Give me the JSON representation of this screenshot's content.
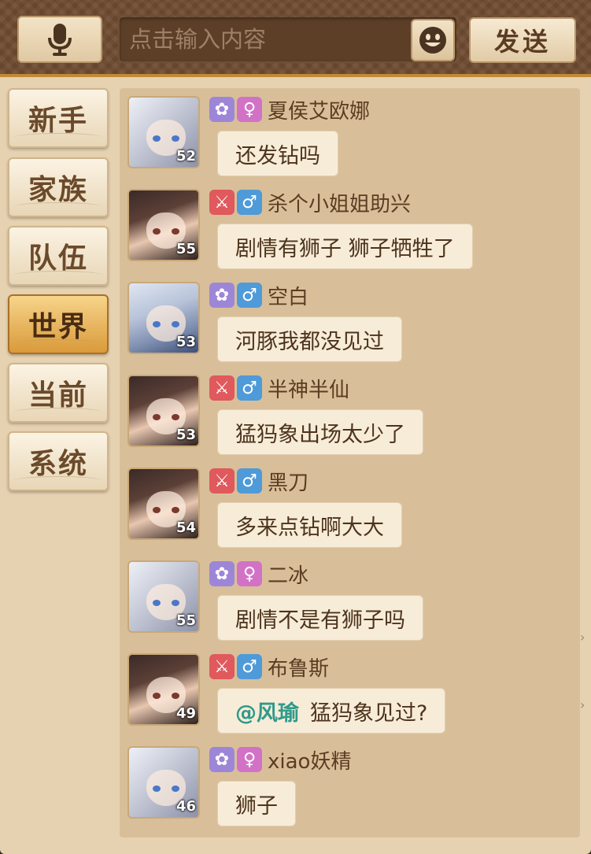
{
  "input": {
    "placeholder": "点击输入内容"
  },
  "toolbar": {
    "send_label": "发送"
  },
  "tabs": [
    {
      "label": "新手",
      "active": false
    },
    {
      "label": "家族",
      "active": false
    },
    {
      "label": "队伍",
      "active": false
    },
    {
      "label": "世界",
      "active": true
    },
    {
      "label": "当前",
      "active": false
    },
    {
      "label": "系统",
      "active": false
    }
  ],
  "messages": [
    {
      "name": "夏侯艾欧娜",
      "level": "52",
      "gender": "♀",
      "faction": "rose",
      "avatar": "silver-hair-girl",
      "text": "还发钻吗"
    },
    {
      "name": "杀个小姐姐助兴",
      "level": "55",
      "gender": "♂",
      "faction": "swords",
      "avatar": "dark-hair-boy",
      "text": "剧情有狮子 狮子牺牲了"
    },
    {
      "name": "空白",
      "level": "53",
      "gender": "♂",
      "faction": "rose",
      "avatar": "pale-hair-boy",
      "text": "河豚我都没见过"
    },
    {
      "name": "半神半仙",
      "level": "53",
      "gender": "♂",
      "faction": "swords",
      "avatar": "dark-hair-boy",
      "text": "猛犸象出场太少了"
    },
    {
      "name": "黑刀",
      "level": "54",
      "gender": "♂",
      "faction": "swords",
      "avatar": "dark-hair-boy",
      "text": "多来点钻啊大大"
    },
    {
      "name": "二冰",
      "level": "55",
      "gender": "♀",
      "faction": "rose",
      "avatar": "silver-hair-girl",
      "text": "剧情不是有狮子吗"
    },
    {
      "name": "布鲁斯",
      "level": "49",
      "gender": "♂",
      "faction": "swords",
      "avatar": "dark-hair-boy",
      "mention": "@风瑜",
      "text": "猛犸象见过?"
    },
    {
      "name": "xiao妖精",
      "level": "46",
      "gender": "♀",
      "faction": "rose",
      "avatar": "silver-hair-girl",
      "text": "狮子"
    }
  ],
  "colors": {
    "accent": "#d99a3a",
    "topbar": "#6d4a2f",
    "panel": "#d8bf99",
    "mention": "#2f9a8a"
  }
}
